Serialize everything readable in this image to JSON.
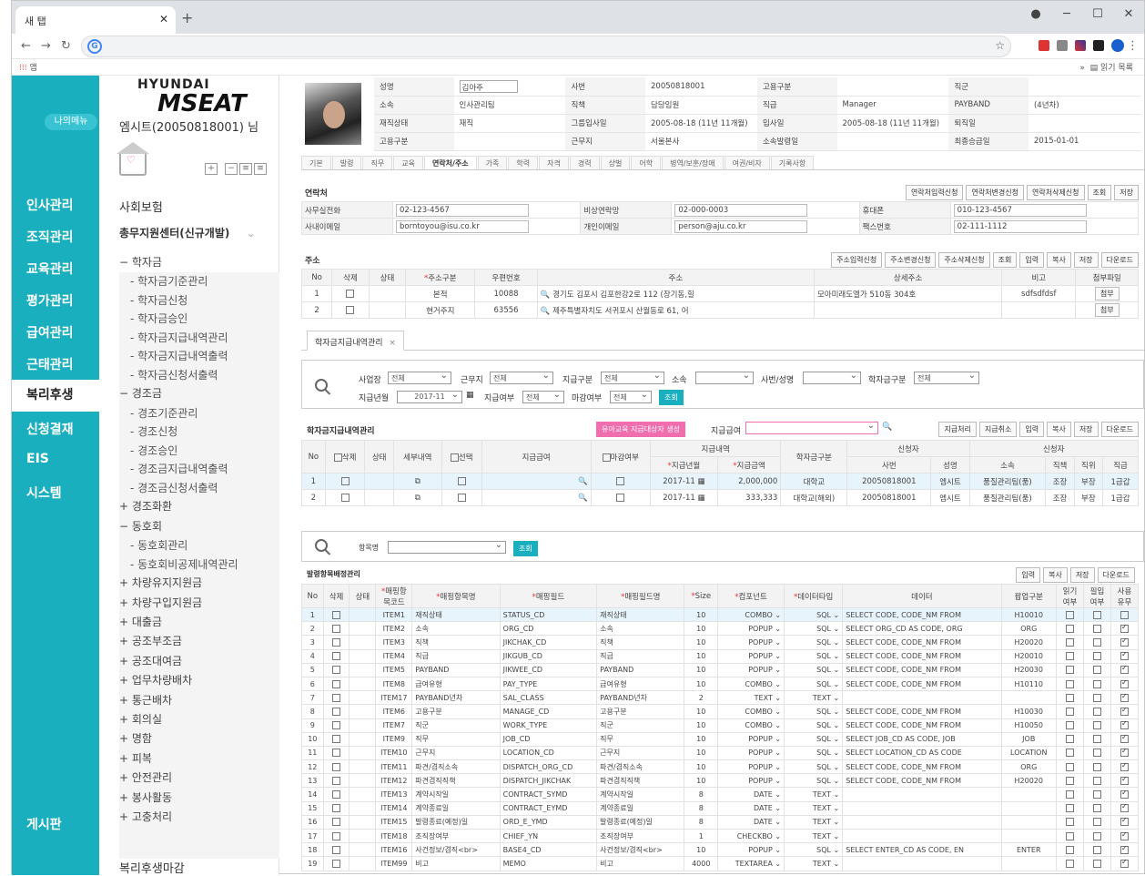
{
  "browser": {
    "tab_title": "새 탭",
    "bookmarks_app": "앱",
    "reading_list": "읽기 목록"
  },
  "app": {
    "my_menu": "나의메뉴",
    "logo_top": "HYUNDAI",
    "logo_main": "MSEAT",
    "user_name": "엠시트(20050818001) 님",
    "left_nav": [
      "인사관리",
      "조직관리",
      "교육관리",
      "평가관리",
      "급여관리",
      "근태관리",
      "복리후생",
      "신청결재",
      "EIS",
      "시스템",
      "게시판"
    ],
    "left_nav_active": "복리후생",
    "side": {
      "social": "사회보험",
      "center": "총무지원센터(신규개발)",
      "groups": [
        {
          "label": "학자금",
          "sign": "−",
          "items": [
            "학자금기준관리",
            "학자금신청",
            "학자금승인",
            "학자금지급내역관리",
            "학자금지급내역출력",
            "학자금신청서출력"
          ]
        },
        {
          "label": "경조금",
          "sign": "−",
          "items": [
            "경조기준관리",
            "경조신청",
            "경조승인",
            "경조금지급내역출력",
            "경조금신청서출력"
          ]
        },
        {
          "label": "경조화환",
          "sign": "+",
          "items": []
        },
        {
          "label": "동호회",
          "sign": "−",
          "items": [
            "동호회관리",
            "동호회비공제내역관리"
          ]
        },
        {
          "label": "차량유지지원금",
          "sign": "+",
          "items": []
        },
        {
          "label": "차량구입지원금",
          "sign": "+",
          "items": []
        },
        {
          "label": "대출금",
          "sign": "+",
          "items": []
        },
        {
          "label": "공조부조금",
          "sign": "+",
          "items": []
        },
        {
          "label": "공조대여금",
          "sign": "+",
          "items": []
        },
        {
          "label": "업무차량배차",
          "sign": "+",
          "items": []
        },
        {
          "label": "통근배차",
          "sign": "+",
          "items": []
        },
        {
          "label": "회의실",
          "sign": "+",
          "items": []
        },
        {
          "label": "명함",
          "sign": "+",
          "items": []
        },
        {
          "label": "피복",
          "sign": "+",
          "items": []
        },
        {
          "label": "안전관리",
          "sign": "+",
          "items": []
        },
        {
          "label": "봉사활동",
          "sign": "+",
          "items": []
        },
        {
          "label": "고충처리",
          "sign": "+",
          "items": []
        }
      ],
      "bottom": "복리후생마감"
    }
  },
  "emp": {
    "rows": [
      [
        [
          "성명",
          "김아주"
        ],
        [
          "사번",
          "20050818001"
        ],
        [
          "고용구분",
          ""
        ],
        [
          "직군",
          ""
        ]
      ],
      [
        [
          "소속",
          "인사관리팀"
        ],
        [
          "직책",
          "담당임원"
        ],
        [
          "직급",
          "Manager"
        ],
        [
          "PAYBAND",
          "(4년차)"
        ]
      ],
      [
        [
          "재직상태",
          "재직"
        ],
        [
          "그룹입사일",
          "2005-08-18 (11년 11개월)"
        ],
        [
          "입사일",
          "2005-08-18 (11년 11개월)"
        ],
        [
          "퇴직일",
          ""
        ]
      ],
      [
        [
          "고용구분",
          ""
        ],
        [
          "근무지",
          "서울본사"
        ],
        [
          "소속발령일",
          ""
        ],
        [
          "최종승급일",
          "2015-01-01"
        ]
      ]
    ],
    "tabs": [
      "기본",
      "발령",
      "직무",
      "교육",
      "연락처/주소",
      "가족",
      "학력",
      "자격",
      "경력",
      "상벌",
      "어학",
      "병역/보훈/장애",
      "여권/비자",
      "기록사항"
    ],
    "active_tab": "연락처/주소"
  },
  "contact": {
    "title": "연락처",
    "buttons": [
      "연락처입력신청",
      "연락처변경신청",
      "연락처삭제신청",
      "조회",
      "저장"
    ],
    "rows": [
      [
        [
          "사무실전화",
          "02-123-4567"
        ],
        [
          "비상연락망",
          "02-000-0003"
        ],
        [
          "휴대폰",
          "010-123-4567"
        ]
      ],
      [
        [
          "사내이메일",
          "borntoyou@isu.co.kr"
        ],
        [
          "개인이메일",
          "person@aju.co.kr"
        ],
        [
          "팩스번호",
          "02-111-1112"
        ]
      ]
    ]
  },
  "address": {
    "title": "주소",
    "buttons": [
      "주소입력신청",
      "주소변경신청",
      "주소삭제신청",
      "조회",
      "입력",
      "복사",
      "저장",
      "다운로드"
    ],
    "headers": [
      "No",
      "삭제",
      "상태",
      "주소구분",
      "우편번호",
      "주소",
      "상세주소",
      "비고",
      "첨부파일"
    ],
    "rows": [
      [
        "1",
        "",
        "",
        "본적",
        "10088",
        "경기도 김포시 김포한강2로 112 (장기동,힐",
        "모아미래도엘가 510동 304호",
        "sdfsdfdsf",
        "첨부"
      ],
      [
        "2",
        "",
        "",
        "현거주지",
        "63556",
        "제주특별자치도 서귀포시 산월동로 61, 어",
        "",
        "",
        "첨부"
      ]
    ]
  },
  "subtab": {
    "label": "학자금지급내역관리",
    "close": "×"
  },
  "search": {
    "labels": [
      "사업장",
      "근무지",
      "지급구분",
      "소속",
      "사번/성명",
      "학자금구분",
      "지급년월",
      "지급여부",
      "마감여부"
    ],
    "all": "전체",
    "month": "2017-11",
    "button": "조회"
  },
  "pay": {
    "title": "학자금지급내역관리",
    "create_btn": "유아교육 지급대상자 생성",
    "pay_label": "지급급여",
    "buttons": [
      "지급처리",
      "지급취소",
      "입력",
      "복사",
      "저장",
      "다운로드"
    ],
    "head_groups": [
      "지급내역",
      "신청자",
      "신청자"
    ],
    "headers": [
      "No",
      "삭제",
      "상태",
      "세부내역",
      "선택",
      "지급급여",
      "마감여부",
      "지급년월",
      "지급금액",
      "학자금구분",
      "사번",
      "성명",
      "소속",
      "직책",
      "직위",
      "직급"
    ],
    "rows": [
      [
        "1",
        "2017-11",
        "2,000,000",
        "대학교",
        "20050818001",
        "엠시트",
        "품질관리팀(품)",
        "조장",
        "부장",
        "1급갑"
      ],
      [
        "2",
        "2017-11",
        "333,333",
        "대학교(해외)",
        "20050818001",
        "엠시트",
        "품질관리팀(품)",
        "조장",
        "부장",
        "1급갑"
      ]
    ]
  },
  "item_search": {
    "label": "항목명",
    "button": "조회"
  },
  "items": {
    "title": "발령항목배정관리",
    "buttons": [
      "입력",
      "복사",
      "저장",
      "다운로드"
    ],
    "headers": [
      "No",
      "삭제",
      "상태",
      "매핑항목코드",
      "매핑항목명",
      "매핑필드",
      "매핑필드명",
      "Size",
      "컴포넌트",
      "데이터타입",
      "데이터",
      "팝업구분",
      "읽기여부",
      "필입여부",
      "사용유무"
    ],
    "rows": [
      [
        "1",
        "ITEM1",
        "재직상태",
        "STATUS_CD",
        "재직상태",
        "10",
        "COMBO",
        "SQL",
        "SELECT CODE, CODE_NM FROM",
        "H10010",
        "0",
        "0",
        "0"
      ],
      [
        "2",
        "ITEM2",
        "소속",
        "ORG_CD",
        "소속",
        "10",
        "POPUP",
        "SQL",
        "SELECT ORG_CD AS CODE, ORG",
        "ORG",
        "0",
        "0",
        "1"
      ],
      [
        "3",
        "ITEM3",
        "직책",
        "JIKCHAK_CD",
        "직책",
        "10",
        "POPUP",
        "SQL",
        "SELECT CODE, CODE_NM FROM",
        "H20020",
        "0",
        "0",
        "1"
      ],
      [
        "4",
        "ITEM4",
        "직급",
        "JIKGUB_CD",
        "직급",
        "10",
        "POPUP",
        "SQL",
        "SELECT CODE, CODE_NM FROM",
        "H20010",
        "0",
        "0",
        "1"
      ],
      [
        "5",
        "ITEM5",
        "PAYBAND",
        "JIKWEE_CD",
        "PAYBAND",
        "10",
        "POPUP",
        "SQL",
        "SELECT CODE, CODE_NM FROM",
        "H20030",
        "0",
        "0",
        "1"
      ],
      [
        "6",
        "ITEM8",
        "급여유형",
        "PAY_TYPE",
        "급여유형",
        "10",
        "COMBO",
        "SQL",
        "SELECT CODE, CODE_NM FROM",
        "H10110",
        "0",
        "0",
        "1"
      ],
      [
        "7",
        "ITEM17",
        "PAYBAND년차",
        "SAL_CLASS",
        "PAYBAND년차",
        "2",
        "TEXT",
        "TEXT",
        "",
        "",
        "0",
        "0",
        "1"
      ],
      [
        "8",
        "ITEM6",
        "고용구분",
        "MANAGE_CD",
        "고용구분",
        "10",
        "COMBO",
        "SQL",
        "SELECT CODE, CODE_NM FROM",
        "H10030",
        "0",
        "0",
        "1"
      ],
      [
        "9",
        "ITEM7",
        "직군",
        "WORK_TYPE",
        "직군",
        "10",
        "COMBO",
        "SQL",
        "SELECT CODE, CODE_NM FROM",
        "H10050",
        "0",
        "0",
        "1"
      ],
      [
        "10",
        "ITEM9",
        "직무",
        "JOB_CD",
        "직무",
        "10",
        "POPUP",
        "SQL",
        "SELECT JOB_CD AS CODE, JOB",
        "JOB",
        "0",
        "0",
        "1"
      ],
      [
        "11",
        "ITEM10",
        "근무지",
        "LOCATION_CD",
        "근무지",
        "10",
        "POPUP",
        "SQL",
        "SELECT LOCATION_CD AS CODE",
        "LOCATION",
        "0",
        "0",
        "1"
      ],
      [
        "12",
        "ITEM11",
        "파견/겸직소속",
        "DISPATCH_ORG_CD",
        "파견/겸직소속",
        "10",
        "POPUP",
        "SQL",
        "SELECT CODE, CODE_NM FROM",
        "ORG",
        "0",
        "0",
        "1"
      ],
      [
        "13",
        "ITEM12",
        "파견겸직직책",
        "DISPATCH_JIKCHAK",
        "파견겸직직책",
        "10",
        "POPUP",
        "SQL",
        "SELECT CODE, CODE_NM FROM",
        "H20020",
        "0",
        "0",
        "1"
      ],
      [
        "14",
        "ITEM13",
        "계약시작일",
        "CONTRACT_SYMD",
        "계약시작일",
        "8",
        "DATE",
        "TEXT",
        "",
        "",
        "0",
        "0",
        "1"
      ],
      [
        "15",
        "ITEM14",
        "계약종료일",
        "CONTRACT_EYMD",
        "계약종료일",
        "8",
        "DATE",
        "TEXT",
        "",
        "",
        "0",
        "0",
        "1"
      ],
      [
        "16",
        "ITEM15",
        "발령종료(예정)일",
        "ORD_E_YMD",
        "발령종료(예정)일",
        "8",
        "DATE",
        "TEXT",
        "",
        "",
        "0",
        "0",
        "1"
      ],
      [
        "17",
        "ITEM18",
        "조직장여부",
        "CHIEF_YN",
        "조직장여부",
        "1",
        "CHECKBO",
        "TEXT",
        "",
        "",
        "0",
        "0",
        "1"
      ],
      [
        "18",
        "ITEM16",
        "사건정보/겸직<br>",
        "BASE4_CD",
        "사건정보/겸직<br>",
        "10",
        "POPUP",
        "SQL",
        "SELECT ENTER_CD AS CODE, EN",
        "ENTER",
        "0",
        "0",
        "1"
      ],
      [
        "19",
        "ITEM99",
        "비고",
        "MEMO",
        "비고",
        "4000",
        "TEXTAREA",
        "TEXT",
        "",
        "",
        "0",
        "0",
        "1"
      ]
    ]
  }
}
